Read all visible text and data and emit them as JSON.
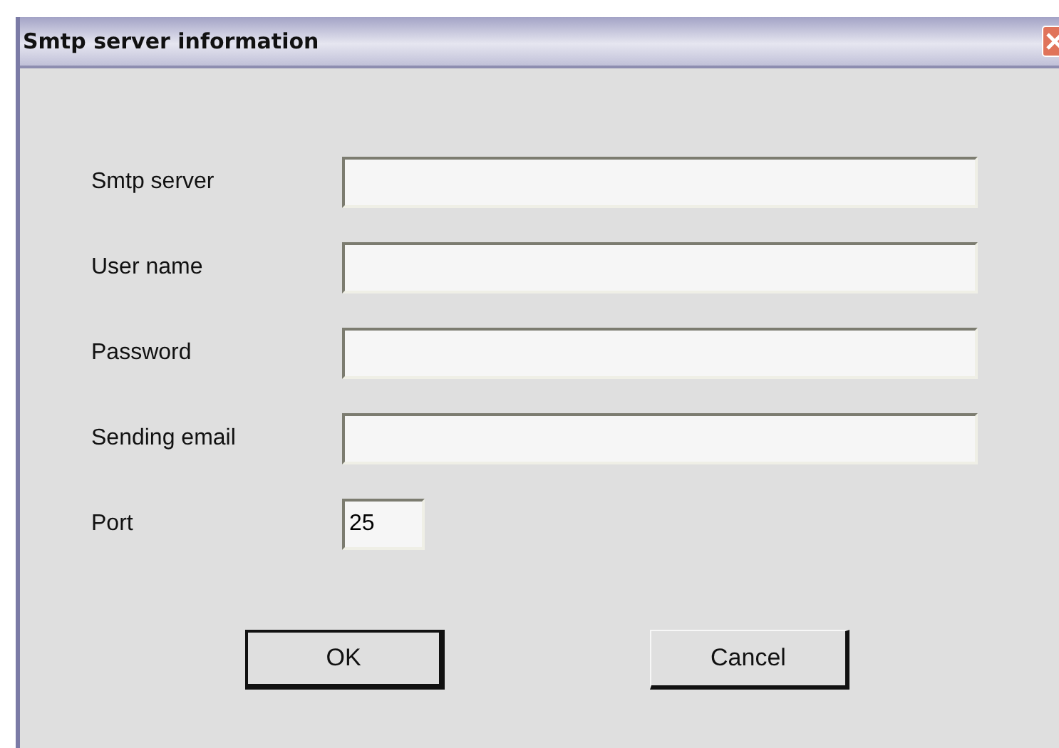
{
  "window": {
    "title": "Smtp server information"
  },
  "fields": [
    {
      "label": "Smtp server",
      "kind": "wide"
    },
    {
      "label": "User name",
      "kind": "wide"
    },
    {
      "label": "Password",
      "kind": "wide"
    },
    {
      "label": "Sending email",
      "kind": "wide"
    },
    {
      "label": "Port",
      "kind": "short",
      "value": "25"
    }
  ],
  "buttons": [
    {
      "label": "OK",
      "default": true
    },
    {
      "label": "Cancel",
      "default": false
    }
  ]
}
